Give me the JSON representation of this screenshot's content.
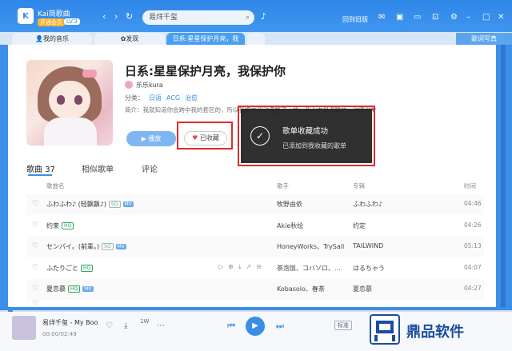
{
  "app": {
    "user_name": "Kai简歌曲",
    "vip_badge": "开通会员",
    "level_badge": "LV.3",
    "search_value": "易烊千玺",
    "back_old": "回到旧版",
    "top_icons": [
      "mail-icon",
      "shirt-icon",
      "settings-icon",
      "minimize-icon",
      "maximize-icon",
      "close-icon"
    ]
  },
  "tabs": [
    {
      "label": "我的音乐"
    },
    {
      "label": "发现"
    },
    {
      "label": "日系:星星保护月亮，我"
    }
  ],
  "tab_right": "歌词写真",
  "playlist": {
    "title": "日系:星星保护月亮，我保护你",
    "creator": "乐乐kura",
    "category_label": "分类：",
    "tags": [
      "日语",
      "ACG",
      "治愈"
    ],
    "intro": "简介：我就知道你会跨中我的套区的，所以我把中和动漫整了一些，我心中最温暖的一对原创♥",
    "play_label": "播放",
    "fav_label": "已收藏"
  },
  "toast": {
    "title": "歌单收藏成功",
    "subtitle": "已添加到我收藏的歌单"
  },
  "song_tabs": {
    "songs": "歌曲",
    "songs_count": "37",
    "similar": "相似歌单",
    "comments": "评论"
  },
  "table": {
    "headers": {
      "name": "歌曲名",
      "artist": "歌手",
      "album": "专辑",
      "time": "时间"
    },
    "rows": [
      {
        "name": "ふわふわ♪ (轻飘飘♪)",
        "chips": [
          "SQ",
          "MV"
        ],
        "artist": "牧野由依",
        "album": "ふわふわ♪",
        "time": "04:46"
      },
      {
        "name": "约束",
        "chips": [
          "HQ"
        ],
        "artist": "Akie秋绘",
        "album": "约定",
        "time": "04:26"
      },
      {
        "name": "センパイ。(前辈。)",
        "chips": [
          "SQ",
          "MV"
        ],
        "artist": "HoneyWorks、TrySail",
        "album": "TAILWIND",
        "time": "05:13"
      },
      {
        "name": "ふたりごと",
        "chips": [
          "HQ"
        ],
        "artist": "茶泡饭、コバソロ、...",
        "album": "はるちゃう",
        "time": "04:07"
      },
      {
        "name": "夏恋慕",
        "chips": [
          "HQ",
          "MV"
        ],
        "artist": "Kobasolo、春茶",
        "album": "夏恋慕",
        "time": "04:27"
      },
      {
        "name": "",
        "chips": [],
        "artist": "",
        "album": "",
        "time": ""
      }
    ]
  },
  "player": {
    "song": "易烊千玺 - My Boo",
    "time": "00:00/02:49",
    "quality": "标准",
    "badge": "1W"
  },
  "watermark": {
    "text": "鼎品软件"
  },
  "colors": {
    "accent": "#3a8ee8",
    "highlight": "#e02b2b",
    "toast_bg": "#1e1e1e"
  }
}
